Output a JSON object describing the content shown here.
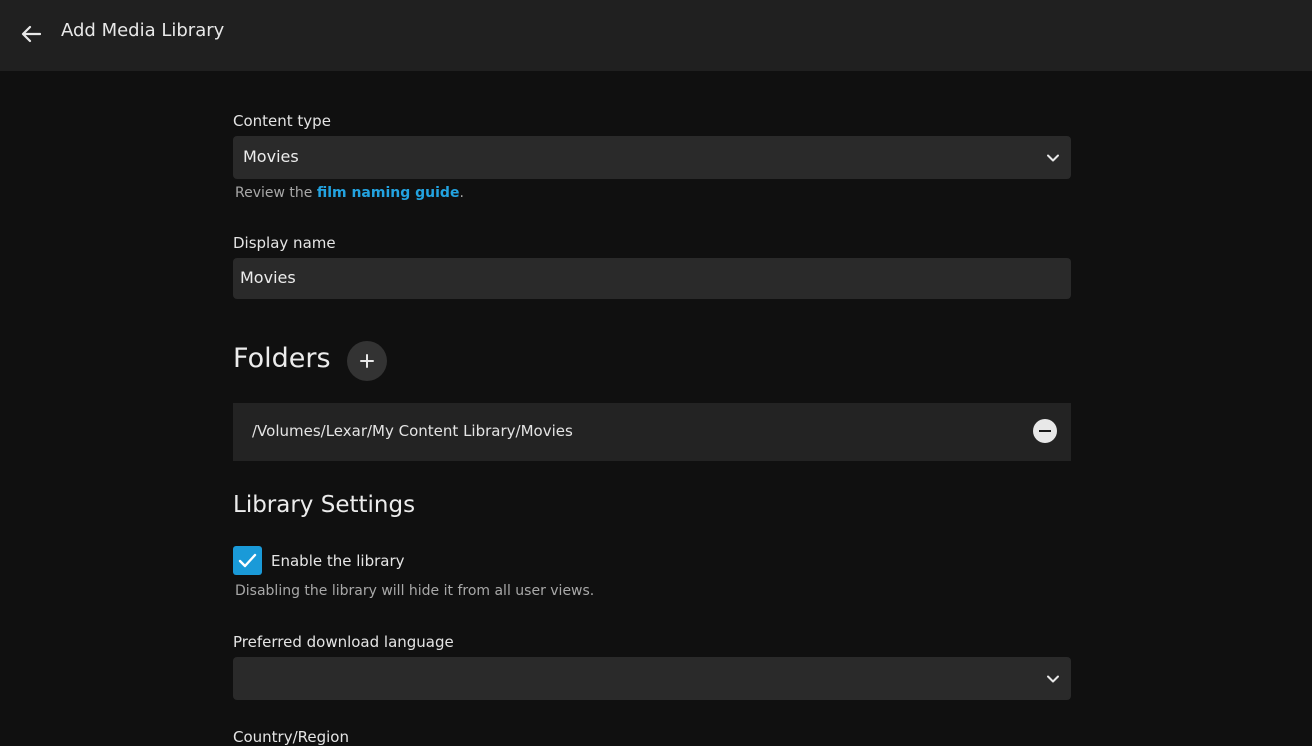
{
  "header": {
    "title": "Add Media Library",
    "back_icon": "arrow-left-icon"
  },
  "content_type": {
    "label": "Content type",
    "value": "Movies"
  },
  "naming_help": {
    "prefix": "Review the ",
    "link": "film naming guide",
    "suffix": "."
  },
  "display_name": {
    "label": "Display name",
    "value": "Movies"
  },
  "folders": {
    "heading": "Folders",
    "items": [
      "/Volumes/Lexar/My Content Library/Movies"
    ]
  },
  "library_settings": {
    "heading": "Library Settings",
    "enable_label": "Enable the library",
    "enable_checked": true,
    "enable_help": "Disabling the library will hide it from all user views."
  },
  "download_language": {
    "label": "Preferred download language",
    "value": ""
  },
  "country_region": {
    "label": "Country/Region"
  },
  "colors": {
    "accent": "#1a9ad8",
    "link": "#23a3e0",
    "background": "#101010",
    "header": "#202020"
  }
}
